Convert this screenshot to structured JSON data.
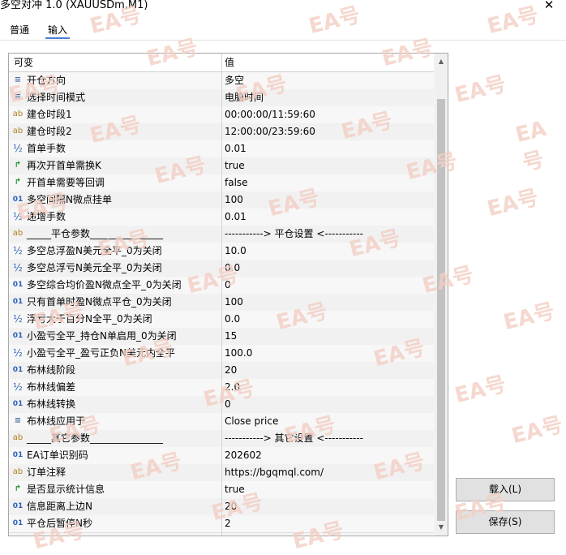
{
  "window": {
    "title": "多空对冲 1.0 (XAUUSDm,M1)",
    "close_label": "✕"
  },
  "tabs": [
    {
      "label": "普通",
      "active": false
    },
    {
      "label": "输入",
      "active": true
    }
  ],
  "grid": {
    "headers": {
      "variable": "可变",
      "value": "值"
    },
    "rows": [
      {
        "icon": "enum",
        "name": "开仓方向",
        "value": "多空"
      },
      {
        "icon": "enum",
        "name": "选择时间模式",
        "value": "电脑时间"
      },
      {
        "icon": "ab",
        "name": "建仓时段1",
        "value": "00:00:00/11:59:60"
      },
      {
        "icon": "ab",
        "name": "建仓时段2",
        "value": "12:00:00/23:59:60"
      },
      {
        "icon": "half",
        "name": "首单手数",
        "value": "0.01"
      },
      {
        "icon": "bool",
        "name": "再次开首单需换K",
        "value": "true"
      },
      {
        "icon": "bool",
        "name": "开首单需要等回调",
        "value": "false"
      },
      {
        "icon": "num",
        "name": "多空间隔N微点挂单",
        "value": "100"
      },
      {
        "icon": "half",
        "name": "递增手数",
        "value": "0.01"
      },
      {
        "icon": "ab",
        "name": "_____平仓参数_______________",
        "value": "-----------> 平仓设置 <-----------"
      },
      {
        "icon": "half",
        "name": "多空总浮盈N美元全平_0为关闭",
        "value": "10.0"
      },
      {
        "icon": "half",
        "name": "多空总浮亏N美元全平_0为关闭",
        "value": "0.0"
      },
      {
        "icon": "num",
        "name": "多空综合均价盈N微点全平_0为关闭",
        "value": "0"
      },
      {
        "icon": "num",
        "name": "只有首单时盈N微点平仓_0为关闭",
        "value": "100"
      },
      {
        "icon": "half",
        "name": "浮亏大于百分N全平_0为关闭",
        "value": "0.0"
      },
      {
        "icon": "num",
        "name": "小盈亏全平_持仓N单启用_0为关闭",
        "value": "15"
      },
      {
        "icon": "half",
        "name": "小盈亏全平_盈亏正负N美元内全平",
        "value": "100.0"
      },
      {
        "icon": "num",
        "name": "布林线阶段",
        "value": "20"
      },
      {
        "icon": "half",
        "name": "布林线偏差",
        "value": "2.0"
      },
      {
        "icon": "num",
        "name": "布林线转换",
        "value": "0"
      },
      {
        "icon": "enum",
        "name": "布林线应用于",
        "value": "Close price"
      },
      {
        "icon": "ab",
        "name": "_____其它参数_______________",
        "value": "-----------> 其它设置 <-----------"
      },
      {
        "icon": "num",
        "name": "EA订单识别码",
        "value": "202602"
      },
      {
        "icon": "ab",
        "name": "订单注释",
        "value": "https://bgqmql.com/"
      },
      {
        "icon": "bool",
        "name": "是否显示统计信息",
        "value": "true"
      },
      {
        "icon": "num",
        "name": "信息距离上边N",
        "value": "20"
      },
      {
        "icon": "num",
        "name": "平仓后暂停N秒",
        "value": "2"
      }
    ],
    "icon_glyphs": {
      "enum": "≡",
      "ab": "ab",
      "half": "½",
      "bool": "↱",
      "num": "01"
    }
  },
  "buttons": {
    "load": "载入(L)",
    "save": "保存(S)"
  },
  "watermark_text": "EA号"
}
